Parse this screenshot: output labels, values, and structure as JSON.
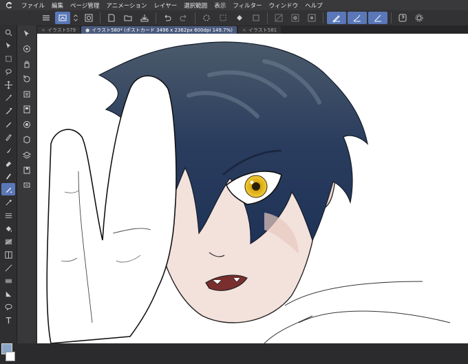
{
  "menu": {
    "items": [
      "ファイル",
      "編集",
      "ページ管理",
      "アニメーション",
      "レイヤー",
      "選択範囲",
      "表示",
      "フィルター",
      "ウィンドウ",
      "ヘルプ"
    ]
  },
  "tabs": [
    {
      "label": "イラスト579",
      "active": false,
      "close": "×"
    },
    {
      "label": "イラスト580* (ポストカード 3496 x 2362px 600dpi 149.7%)",
      "active": true,
      "close": "●"
    },
    {
      "label": "イラスト581",
      "active": false,
      "close": "×"
    }
  ],
  "colors": {
    "accent": "#5a78b8",
    "hair": "#253752",
    "eye": "#d4a20a",
    "skin": "#f3e2dc"
  },
  "icons": {
    "toolbar": [
      "menu-icon",
      "canvas-icon",
      "updown-icon",
      "new-file-icon",
      "open-folder-icon",
      "save-icon",
      "undo-icon",
      "redo-icon",
      "clear-icon",
      "fill-icon",
      "transform-icon",
      "crop-icon",
      "select-icon",
      "pen-stabilizer-icon-1",
      "pen-stabilizer-icon-2",
      "pen-stabilizer-icon-3",
      "help-icon",
      "settings-icon"
    ],
    "tools": [
      "zoom-icon",
      "move-icon",
      "object-icon",
      "lasso-icon",
      "move-layer-icon",
      "wand-icon",
      "eyedropper-icon",
      "pen-icon",
      "pencil-icon",
      "brush-icon",
      "eraser-icon",
      "blend-icon",
      "airbrush-icon",
      "deco-icon",
      "fill-icon",
      "text-icon",
      "gradient-icon",
      "figure-icon",
      "frame-icon",
      "ruler-icon",
      "balloon-icon",
      "correct-line-icon"
    ]
  }
}
